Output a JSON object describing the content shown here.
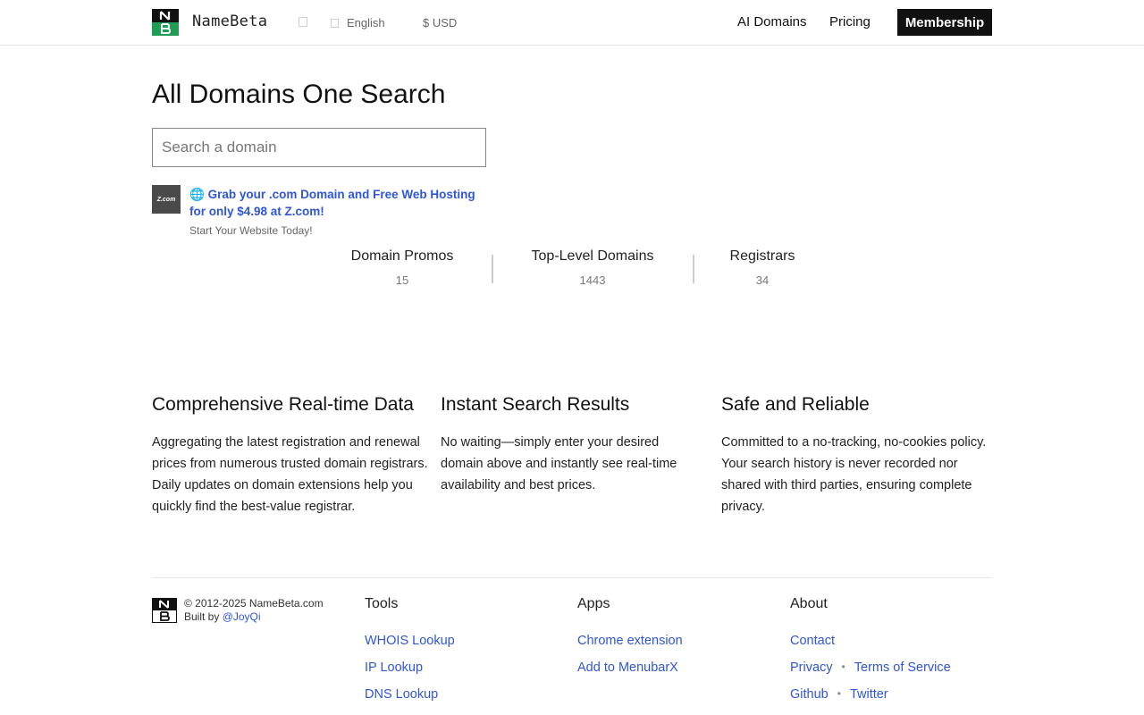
{
  "header": {
    "brand": "NameBeta",
    "language": "English",
    "currency": "$ USD",
    "nav": [
      "AI Domains",
      "Pricing"
    ],
    "membership": "Membership"
  },
  "hero": {
    "title": "All Domains One Search",
    "search_placeholder": "Search a domain"
  },
  "promo": {
    "logo_text": "Z.com",
    "icon": "🌐",
    "title": "Grab your .com Domain and Free Web Hosting for only $4.98 at Z.com!",
    "subtitle": "Start Your Website Today!"
  },
  "stats": [
    {
      "label": "Domain Promos",
      "value": "15"
    },
    {
      "label": "Top-Level Domains",
      "value": "1443"
    },
    {
      "label": "Registrars",
      "value": "34"
    }
  ],
  "features": [
    {
      "title": "Comprehensive Real-time Data",
      "text": "Aggregating the latest registration and renewal prices from numerous trusted domain registrars. Daily updates on domain extensions help you quickly find the best-value registrar."
    },
    {
      "title": "Instant Search Results",
      "text": "No waiting—simply enter your desired domain above and instantly see real-time availability and best prices."
    },
    {
      "title": "Safe and Reliable",
      "text": "Committed to a no-tracking, no-cookies policy. Your search history is never recorded nor shared with third parties, ensuring complete privacy."
    }
  ],
  "footer": {
    "copyright": "© 2012-2025 NameBeta.com",
    "built_by": "Built by",
    "author": "@JoyQi",
    "tools": {
      "title": "Tools",
      "links": [
        "WHOIS Lookup",
        "IP Lookup",
        "DNS Lookup"
      ]
    },
    "apps": {
      "title": "Apps",
      "links": [
        "Chrome extension",
        "Add to MenubarX"
      ]
    },
    "about": {
      "title": "About",
      "contact": "Contact",
      "privacy": "Privacy",
      "terms": "Terms of Service",
      "github": "Github",
      "twitter": "Twitter",
      "separator": "•"
    }
  },
  "colors": {
    "accent": "#111111",
    "link": "#2f56d8",
    "logo_green": "#1f9d55"
  }
}
